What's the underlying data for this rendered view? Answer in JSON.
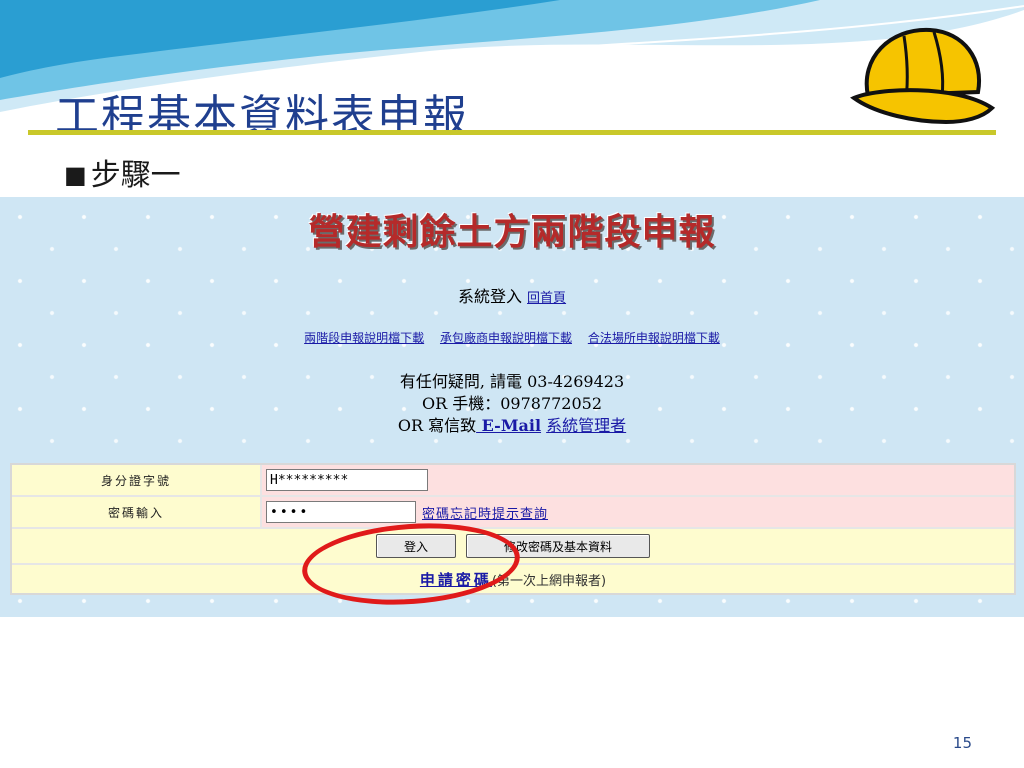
{
  "slide": {
    "title": "工程基本資料表申報",
    "subtitle_bullet": "■",
    "subtitle": "步驟一",
    "page_number": "15"
  },
  "site": {
    "banner": "營建剩餘土方兩階段申報",
    "login_label": "系統登入",
    "home_link": "回首頁",
    "download_links": [
      "兩階段申報說明檔下載",
      "承包廠商申報說明檔下載",
      "合法場所申報說明檔下載"
    ],
    "contact_line1": "有任何疑問, 請電 03-4269423",
    "contact_line2": "OR 手機：0978772052",
    "contact_line3_prefix": "OR 寫信致",
    "email_link": " E-Mail",
    "admin_link": "系統管理者"
  },
  "form": {
    "id_label": "身分證字號",
    "id_value": "H*********",
    "password_label": "密碼輸入",
    "password_value": "••••",
    "forgot_link": "密碼忘記時提示查詢",
    "login_button": "登入",
    "modify_button": "修改密碼及基本資料",
    "apply_link": "申請密碼",
    "apply_note": "(第一次上網申報者)"
  },
  "colors": {
    "title": "#1f3f8f",
    "rule": "#c9c82a",
    "highlight_ring": "#e01a1a",
    "label_cell": "#fefccf",
    "input_cell": "#fde0e0",
    "page_background": "#cfe6f4"
  },
  "icons": {
    "helmet": "hard-hat-icon"
  }
}
